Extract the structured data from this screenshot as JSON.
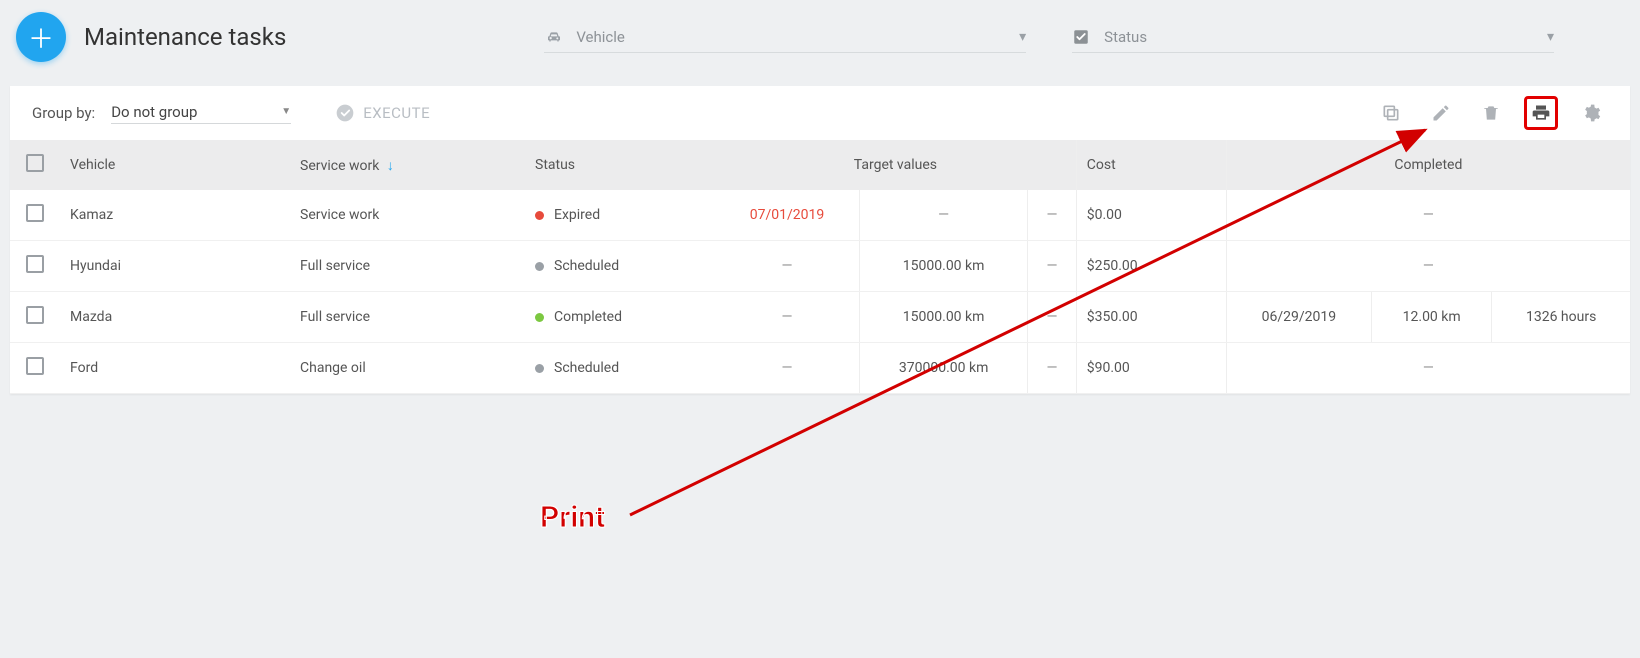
{
  "header": {
    "title": "Maintenance tasks",
    "add_tooltip": "Add",
    "filter_vehicle": "Vehicle",
    "filter_status": "Status"
  },
  "toolbar": {
    "group_by_label": "Group by:",
    "group_by_value": "Do not group",
    "execute_label": "EXECUTE"
  },
  "columns": {
    "vehicle": "Vehicle",
    "service_work": "Service work",
    "status": "Status",
    "target_values": "Target values",
    "cost": "Cost",
    "completed": "Completed"
  },
  "rows": [
    {
      "vehicle": "Kamaz",
      "service": "Service work",
      "status": "Expired",
      "status_color": "red",
      "tv_date": "07/01/2019",
      "tv_date_red": true,
      "tv_km": "—",
      "tv_hours": "—",
      "cost": "$0.00",
      "c_date": "—",
      "c_km": "",
      "c_hours": ""
    },
    {
      "vehicle": "Hyundai",
      "service": "Full service",
      "status": "Scheduled",
      "status_color": "grey",
      "tv_date": "—",
      "tv_date_red": false,
      "tv_km": "15000.00 km",
      "tv_hours": "—",
      "cost": "$250.00",
      "c_date": "—",
      "c_km": "",
      "c_hours": ""
    },
    {
      "vehicle": "Mazda",
      "service": "Full service",
      "status": "Completed",
      "status_color": "green",
      "tv_date": "—",
      "tv_date_red": false,
      "tv_km": "15000.00 km",
      "tv_hours": "—",
      "cost": "$350.00",
      "c_date": "06/29/2019",
      "c_km": "12.00 km",
      "c_hours": "1326 hours"
    },
    {
      "vehicle": "Ford",
      "service": "Change oil",
      "status": "Scheduled",
      "status_color": "grey",
      "tv_date": "—",
      "tv_date_red": false,
      "tv_km": "370000.00 km",
      "tv_hours": "—",
      "cost": "$90.00",
      "c_date": "—",
      "c_km": "",
      "c_hours": ""
    }
  ],
  "annotation": {
    "label": "Print"
  }
}
